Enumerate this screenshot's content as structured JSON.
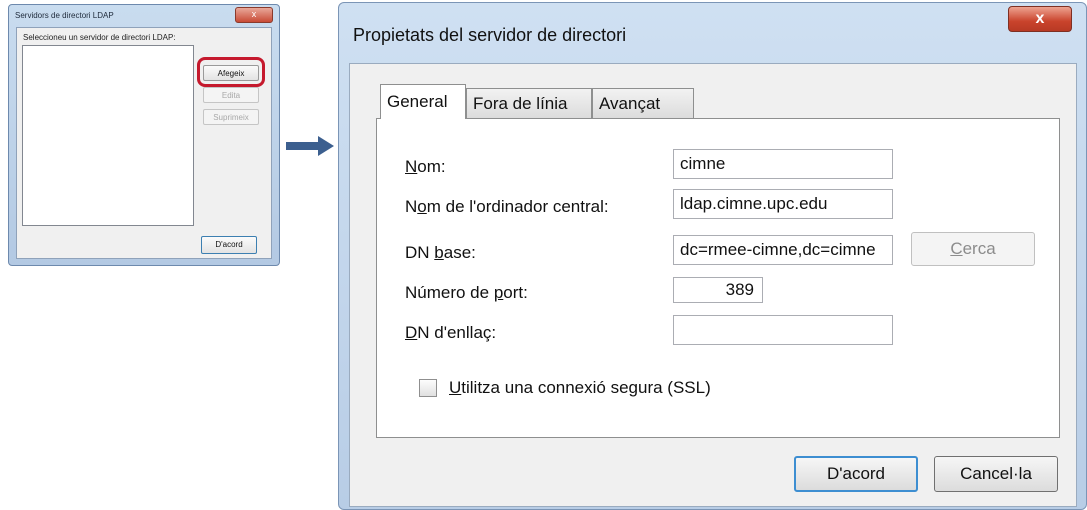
{
  "small_dialog": {
    "title": "Servidors de directori LDAP",
    "close_glyph": "x",
    "list_label": "Seleccioneu un servidor de directori LDAP:",
    "buttons": {
      "add": "Afegeix",
      "edit": "Edita",
      "delete": "Suprimeix",
      "ok": "D'acord"
    }
  },
  "arrow_icon": "right-arrow-icon",
  "big_dialog": {
    "title": "Propietats del servidor de directori",
    "close_glyph": "x",
    "tabs": [
      {
        "label": "General",
        "active": true
      },
      {
        "label": "Fora de línia",
        "active": false
      },
      {
        "label": "Avançat",
        "active": false
      }
    ],
    "fields": {
      "name": {
        "label_u": "N",
        "label_rest": "om:",
        "value": "cimne"
      },
      "hostname": {
        "label_pre": "N",
        "label_u": "o",
        "label_rest": "m de l'ordinador central:",
        "value": "ldap.cimne.upc.edu"
      },
      "base_dn": {
        "label_pre": "DN ",
        "label_u": "b",
        "label_rest": "ase:",
        "value": "dc=rmee-cimne,dc=cimne"
      },
      "port": {
        "label_pre": "Número de ",
        "label_u": "p",
        "label_rest": "ort:",
        "value": "389"
      },
      "bind_dn": {
        "label_u": "D",
        "label_rest": "N d'enllaç:",
        "value": ""
      }
    },
    "search_button": {
      "label_u": "C",
      "label_rest": "erca"
    },
    "ssl": {
      "label_u": "U",
      "label_rest": "tilitza una connexió segura (SSL)",
      "checked": false
    },
    "ok_button": "D'acord",
    "cancel_button": "Cancel·la"
  }
}
